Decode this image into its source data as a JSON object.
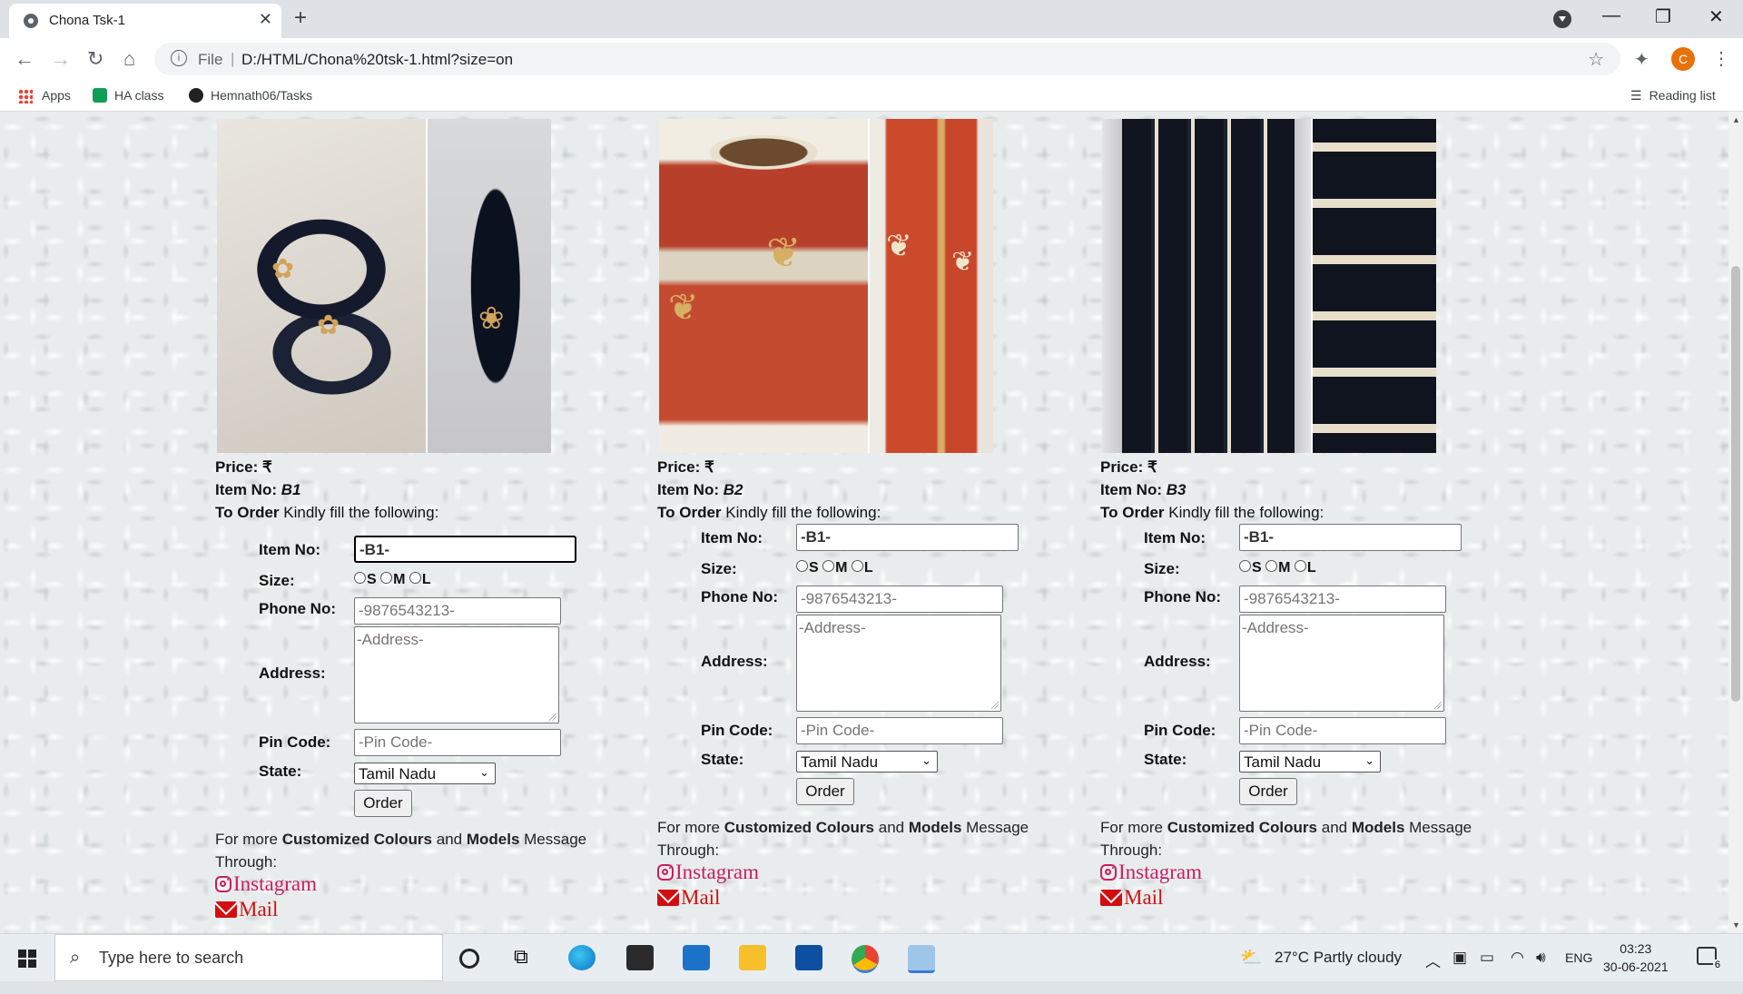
{
  "browser": {
    "tab_title": "Chona Tsk-1",
    "url_scheme": "File",
    "url": "D:/HTML/Chona%20tsk-1.html?size=on",
    "avatar_letter": "C",
    "bookmarks": [
      "Apps",
      "HA class",
      "Hemnath06/Tasks"
    ],
    "reading_list": "Reading list"
  },
  "products": [
    {
      "price_label": "Price: ₹",
      "item_label": "Item No:",
      "item_no": "B1",
      "order_label": "To Order",
      "order_text": "Kindly fill the following:",
      "form": {
        "item_label": "Item No:",
        "item_value": "-B1-",
        "size_label": "Size:",
        "sizes": [
          "S",
          "M",
          "L"
        ],
        "phone_label": "Phone No:",
        "phone_placeholder": "-9876543213-",
        "address_label": "Address:",
        "address_placeholder": "-Address-",
        "pin_label": "Pin Code:",
        "pin_placeholder": "-Pin Code-",
        "state_label": "State:",
        "state_value": "Tamil Nadu",
        "order_button": "Order"
      },
      "more_pre": "For more",
      "more_b1": "Customized Colours",
      "more_and": "and",
      "more_b2": "Models",
      "more_post": "Message Through:",
      "instagram": "Instagram",
      "mail": "Mail"
    },
    {
      "price_label": "Price: ₹",
      "item_label": "Item No:",
      "item_no": "B2",
      "order_label": "To Order",
      "order_text": "Kindly fill the following:",
      "form": {
        "item_label": "Item No:",
        "item_value": "-B1-",
        "size_label": "Size:",
        "sizes": [
          "S",
          "M",
          "L"
        ],
        "phone_label": "Phone No:",
        "phone_placeholder": "-9876543213-",
        "address_label": "Address:",
        "address_placeholder": "-Address-",
        "pin_label": "Pin Code:",
        "pin_placeholder": "-Pin Code-",
        "state_label": "State:",
        "state_value": "Tamil Nadu",
        "order_button": "Order"
      },
      "more_pre": "For more",
      "more_b1": "Customized Colours",
      "more_and": "and",
      "more_b2": "Models",
      "more_post": "Message Through:",
      "instagram": "Instagram",
      "mail": "Mail"
    },
    {
      "price_label": "Price: ₹",
      "item_label": "Item No:",
      "item_no": "B3",
      "order_label": "To Order",
      "order_text": "Kindly fill the following:",
      "form": {
        "item_label": "Item No:",
        "item_value": "-B1-",
        "size_label": "Size:",
        "sizes": [
          "S",
          "M",
          "L"
        ],
        "phone_label": "Phone No:",
        "phone_placeholder": "-9876543213-",
        "address_label": "Address:",
        "address_placeholder": "-Address-",
        "pin_label": "Pin Code:",
        "pin_placeholder": "-Pin Code-",
        "state_label": "State:",
        "state_value": "Tamil Nadu",
        "order_button": "Order"
      },
      "more_pre": "For more",
      "more_b1": "Customized Colours",
      "more_and": "and",
      "more_b2": "Models",
      "more_post": "Message Through:",
      "instagram": "Instagram",
      "mail": "Mail"
    }
  ],
  "taskbar": {
    "search_placeholder": "Type here to search",
    "weather": "27°C  Partly cloudy",
    "language": "ENG",
    "time": "03:23",
    "date": "30-06-2021",
    "notifications": "6"
  },
  "colors": {
    "instagram": "#c81e5e",
    "mail": "#d10f10",
    "avatar": "#e8710a"
  }
}
